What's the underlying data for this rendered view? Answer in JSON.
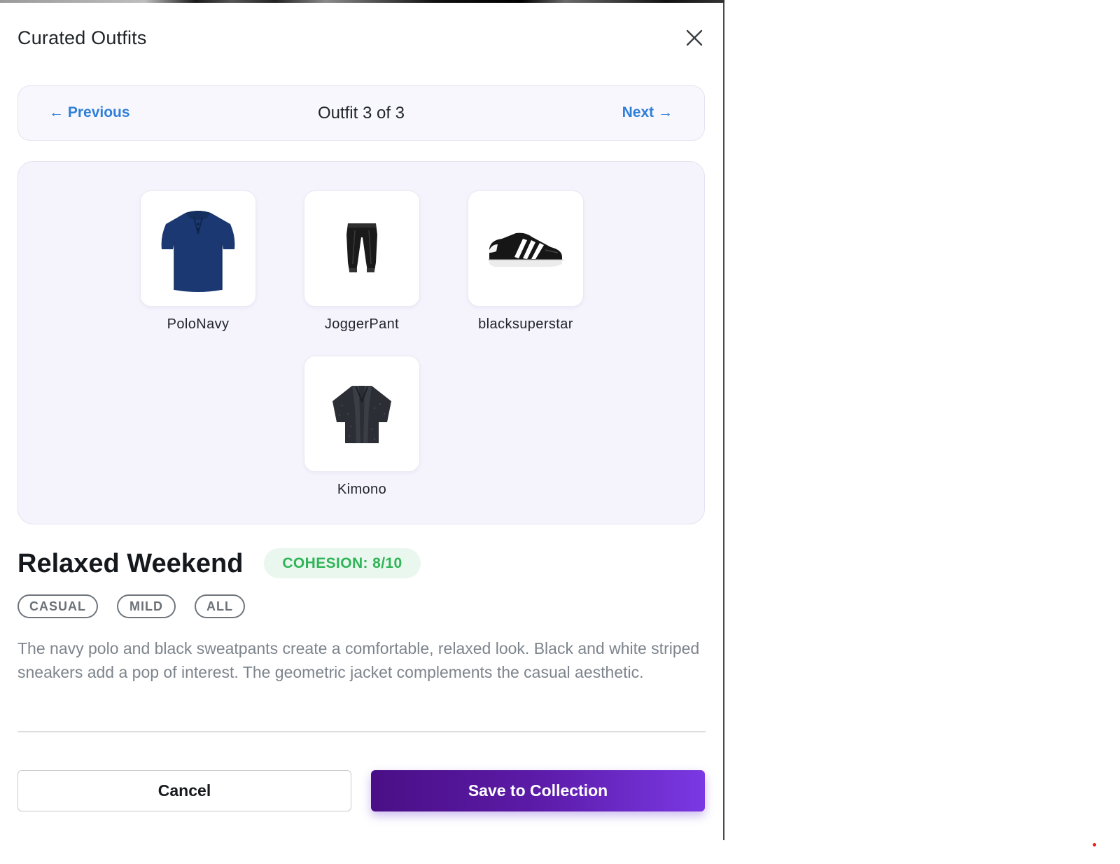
{
  "modal": {
    "title": "Curated Outfits"
  },
  "navigation": {
    "prev_label": "← Previous",
    "counter": "Outfit 3 of 3",
    "next_label": "Next →"
  },
  "items": [
    {
      "name": "PoloNavy",
      "icon": "polo-shirt-icon"
    },
    {
      "name": "JoggerPant",
      "icon": "jogger-pant-icon"
    },
    {
      "name": "blacksuperstar",
      "icon": "sneaker-icon"
    },
    {
      "name": "Kimono",
      "icon": "kimono-icon"
    }
  ],
  "outfit": {
    "title": "Relaxed Weekend",
    "cohesion": "COHESION: 8/10",
    "tags": [
      "CASUAL",
      "MILD",
      "ALL"
    ],
    "description": "The navy polo and black sweatpants create a comfortable, relaxed look. Black and white striped sneakers add a pop of interest. The geometric jacket complements the casual aesthetic."
  },
  "actions": {
    "cancel_label": "Cancel",
    "save_label": "Save to Collection"
  },
  "colors": {
    "accent_link": "#2f7fd8",
    "cohesion_green": "#2fb457",
    "primary_gradient_start": "#4a0f86",
    "primary_gradient_end": "#7a38e4"
  }
}
